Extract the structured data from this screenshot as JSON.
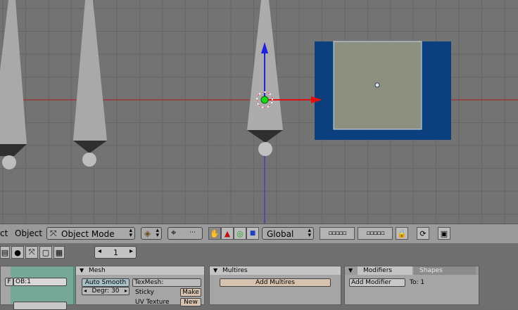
{
  "header": {
    "menu_item": "ct",
    "object_menu": "Object",
    "mode_select": "Object Mode",
    "orientation_select": "Global"
  },
  "buttons_panel": {
    "frame_number": "1",
    "object_name": "OB:1",
    "mesh": {
      "title": "Mesh",
      "auto_smooth": "Auto Smooth",
      "degr": "Degr: 30",
      "texmesh_label": "TexMesh:",
      "sticky_label": "Sticky",
      "sticky_button": "Make",
      "uv_texture_label": "UV Texture",
      "uv_texture_button": "New"
    },
    "multires": {
      "title": "Multires",
      "add_button": "Add Multires"
    },
    "modifiers": {
      "tab_modifiers": "Modifiers",
      "tab_shapes": "Shapes",
      "add_button": "Add Modifier",
      "to_label": "To: 1"
    }
  },
  "colors": {
    "viewport_bg": "#737373",
    "grid": "#656565",
    "selected_face": "#8c9080",
    "selection_highlight": "#0a3a7a",
    "x_axis": "#c81414",
    "z_axis": "#2020d0"
  }
}
